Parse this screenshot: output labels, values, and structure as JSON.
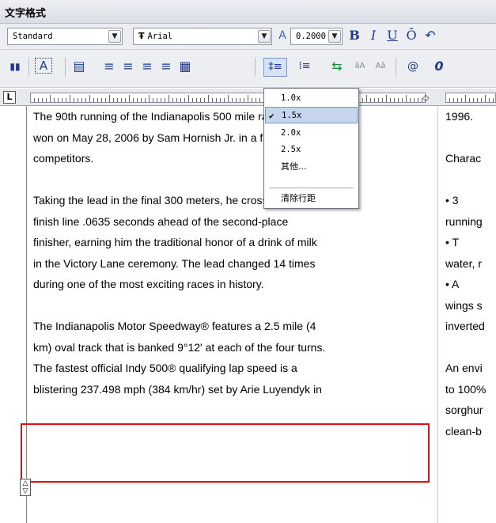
{
  "title": "文字格式",
  "toolbar1": {
    "style_value": "Standard",
    "font_value": "Arial",
    "font_prefix": "Ŧ",
    "height_value": "0.2000",
    "buttons": [
      "B",
      "I",
      "U",
      "Ō",
      "↶"
    ]
  },
  "toolbar2": {
    "buttons": [
      "▮▮",
      "A",
      "▤",
      "≡",
      "≡",
      "≡",
      "≡",
      "▦",
      "‡≡",
      "⁞≡",
      "⇆",
      "ǎA",
      "Aǎ",
      "@",
      "0"
    ]
  },
  "ruler": {
    "tab_marker": "L"
  },
  "menu": {
    "items": [
      {
        "label": "1.0x",
        "checked": false
      },
      {
        "label": "1.5x",
        "checked": true
      },
      {
        "label": "2.0x",
        "checked": false
      },
      {
        "label": "2.5x",
        "checked": false
      },
      {
        "label": "其他...",
        "checked": false
      }
    ],
    "clear_label": "清除行距",
    "check_glyph": "✔"
  },
  "document": {
    "column1_lines": [
      "The 90th running of the Indianapolis 500 mile race was",
      "won on May 28, 2006 by Sam Hornish Jr. in a field of 33",
      "competitors.",
      "",
      "Taking the lead in the final 300 meters, he crossed the",
      "finish line .0635 seconds ahead of the second-place",
      "finisher, earning him the traditional honor of a drink of milk",
      "in the Victory Lane ceremony. The lead changed 14 times",
      "during one of the most exciting races in history.",
      "",
      "The Indianapolis Motor Speedway® features a 2.5 mile (4",
      "km) oval track that is banked 9°12' at each of the four turns.",
      "The fastest official Indy 500® qualifying lap speed is a",
      "blistering 237.498 mph (384 km/hr) set by Arie Luyendyk in"
    ],
    "column2_lines": [
      "1996.",
      "",
      "Charac",
      "",
      "•       3",
      "running",
      "•       T",
      "water, r",
      "•       A",
      "wings s",
      "inverted",
      "",
      "An envi",
      "to 100%",
      "sorghur",
      "clean-b"
    ]
  },
  "colors": {
    "highlight": "#e0101a",
    "menu_selected": "#c6d5ee"
  }
}
